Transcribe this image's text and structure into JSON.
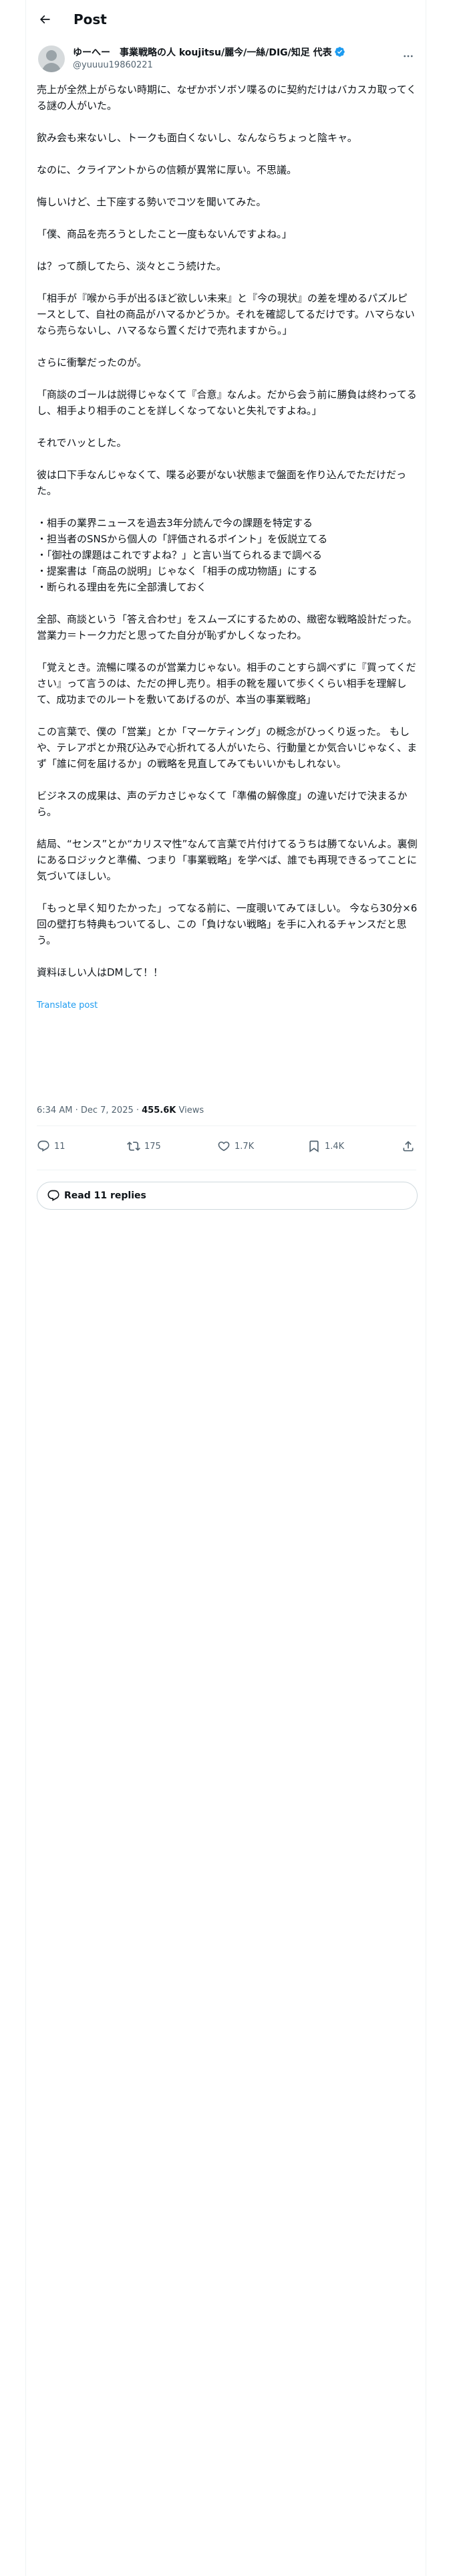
{
  "header": {
    "title": "Post"
  },
  "author": {
    "name": "ゆーへー　事業戦略の人 koujitsu/麗今/一絲/DIG/知足 代表",
    "handle": "@yuuuu19860221"
  },
  "post": {
    "paragraphs": [
      "売上が全然上がらない時期に、なぜかボソボソ喋るのに契約だけはバカスカ取ってくる謎の人がいた。",
      "飲み会も来ないし、トークも面白くないし、なんならちょっと陰キャ。",
      "なのに、クライアントからの信頼が異常に厚い。不思議。",
      "悔しいけど、土下座する勢いでコツを聞いてみた。",
      "「僕、商品を売ろうとしたこと一度もないんですよね。」",
      "は？って顔してたら、淡々とこう続けた。",
      "「相手が『喉から手が出るほど欲しい未来』と『今の現状』の差を埋めるパズルピースとして、自社の商品がハマるかどうか。それを確認してるだけです。ハマらないなら売らないし、ハマるなら置くだけで売れますから。」",
      "さらに衝撃だったのが。",
      "「商談のゴールは説得じゃなくて『合意』なんよ。だから会う前に勝負は終わってるし、相手より相手のことを詳しくなってないと失礼ですよね。」",
      "それでハッとした。",
      "彼は口下手なんじゃなくて、喋る必要がない状態まで盤面を作り込んでただけだった。",
      "・相手の業界ニュースを過去3年分読んで今の課題を特定する\n・担当者のSNSから個人の「評価されるポイント」を仮説立てる\n・「御社の課題はこれですよね？」と言い当てられるまで調べる\n・提案書は「商品の説明」じゃなく「相手の成功物語」にする\n・断られる理由を先に全部潰しておく",
      "全部、商談という「答え合わせ」をスムーズにするための、緻密な戦略設計だった。 営業力＝トーク力だと思ってた自分が恥ずかしくなったわ。",
      "「覚えとき。流暢に喋るのが営業力じゃない。相手のことすら調べずに『買ってください』って言うのは、ただの押し売り。相手の靴を履いて歩くくらい相手を理解して、成功までのルートを敷いてあげるのが、本当の事業戦略」",
      "この言葉で、僕の「営業」とか「マーケティング」の概念がひっくり返った。 もしや、テレアポとか飛び込みで心折れてる人がいたら、行動量とか気合いじゃなく、まず「誰に何を届けるか」の戦略を見直してみてもいいかもしれない。",
      "ビジネスの成果は、声のデカさじゃなくて「準備の解像度」の違いだけで決まるから。",
      "結局、“センス”とか“カリスマ性”なんて言葉で片付けてるうちは勝てないんよ。裏側にあるロジックと準備、つまり「事業戦略」を学べば、誰でも再現できるってことに気づいてほしい。",
      "「もっと早く知りたかった」ってなる前に、一度覗いてみてほしい。 今なら30分×6回の壁打ち特典もついてるし、この「負けない戦略」を手に入れるチャンスだと思う。",
      "資料ほしい人はDMして！！"
    ],
    "translate_label": "Translate post",
    "time": "6:34 AM · Dec 7, 2025 · ",
    "views_count": "455.6K",
    "views_label": " Views"
  },
  "actions": {
    "replies": "11",
    "reposts": "175",
    "likes": "1.7K",
    "bookmarks": "1.4K"
  },
  "read_replies_label": "Read 11 replies",
  "icons": {
    "back": "back-arrow-icon",
    "more": "more-dots-icon",
    "verified": "verified-badge-icon",
    "reply": "reply-icon",
    "repost": "repost-icon",
    "like": "heart-icon",
    "bookmark": "bookmark-icon",
    "share": "share-icon"
  },
  "colors": {
    "accent": "#1d9bf0",
    "muted": "#536471",
    "text": "#0f1419"
  }
}
